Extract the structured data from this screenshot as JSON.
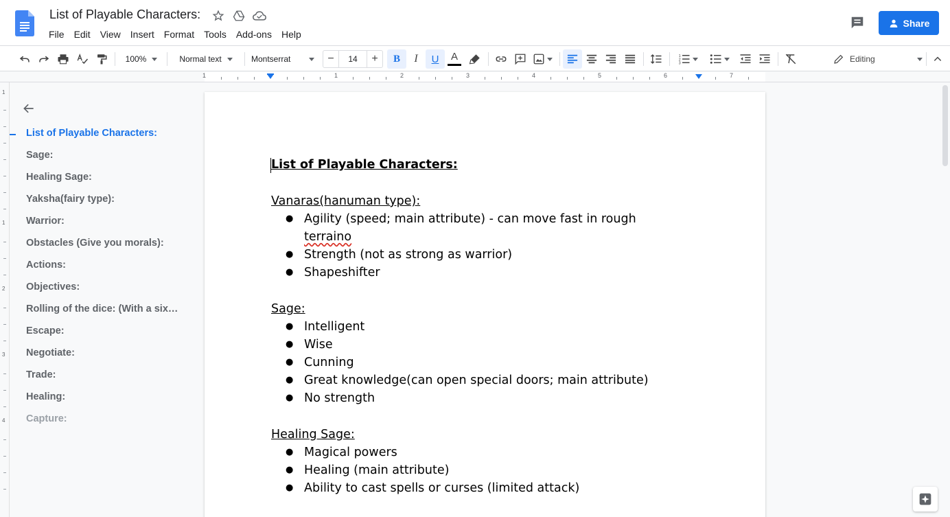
{
  "app": {
    "doc_title": "List of Playable Characters:",
    "icons": [
      "docs-logo",
      "star-icon",
      "move-to-drive-icon",
      "cloud-saved-icon"
    ]
  },
  "menu": [
    "File",
    "Edit",
    "View",
    "Insert",
    "Format",
    "Tools",
    "Add-ons",
    "Help"
  ],
  "share": {
    "label": "Share"
  },
  "toolbar": {
    "zoom": "100%",
    "style": "Normal text",
    "font": "Montserrat",
    "font_size": "14",
    "minus": "−",
    "plus": "+",
    "bold": "B",
    "italic": "I",
    "underline": "U",
    "text_color": "A",
    "mode": "Editing"
  },
  "ruler": {
    "numbers": [
      "1",
      "1",
      "2",
      "3",
      "4",
      "5",
      "6",
      "7"
    ],
    "vertical": [
      "1",
      "1",
      "2",
      "3",
      "4"
    ]
  },
  "outline": {
    "items": [
      "List of Playable Characters:",
      "Sage:",
      "Healing Sage:",
      "Yaksha(fairy type):",
      "Warrior:",
      "Obstacles (Give you morals):",
      "Actions:",
      "Objectives:",
      "Rolling of the dice: (With a six…",
      "Escape:",
      "Negotiate:",
      "Trade:",
      "Healing:",
      "Capture:"
    ]
  },
  "document": {
    "title": "List of Playable Characters:",
    "sections": [
      {
        "heading": "Vanaras(hanuman type):",
        "bullets": [
          "Agility (speed; main attribute) - can move fast in rough",
          "Strength (not as strong as warrior)",
          "Shapeshifter"
        ],
        "wrap_line": "terraino"
      },
      {
        "heading": "Sage:",
        "bullets": [
          "Intelligent",
          "Wise",
          "Cunning",
          "Great knowledge(can open special doors; main attribute)",
          "No strength"
        ]
      },
      {
        "heading": "Healing Sage:",
        "bullets": [
          "Magical powers",
          "Healing (main attribute)",
          "Ability to cast spells or curses (limited attack)"
        ]
      }
    ]
  },
  "colors": {
    "accent": "#1a73e8",
    "share_bg": "#1a73e8",
    "spell_error": "#d93025"
  }
}
